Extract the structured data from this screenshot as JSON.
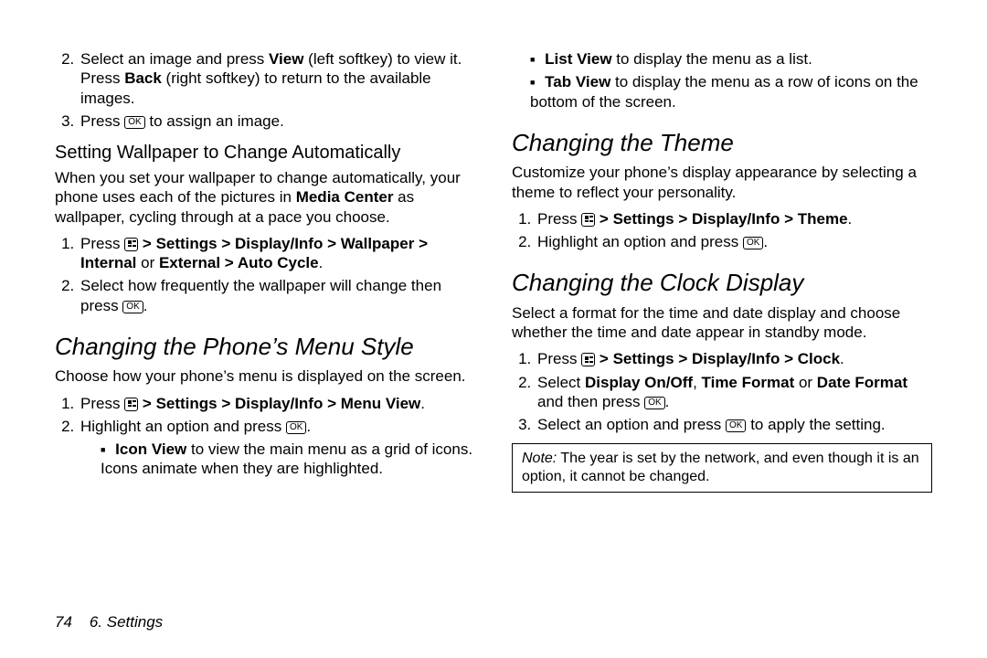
{
  "left": {
    "step2": {
      "prefix": "Select an image and press ",
      "view": "View",
      "mid": " (left softkey) to view it. Press ",
      "back": "Back",
      "suffix": " (right softkey) to return to the available images."
    },
    "step3_a": "Press ",
    "step3_b": " to assign an image.",
    "wall_heading": "Setting Wallpaper to Change Automatically",
    "wall_intro_a": "When you set your wallpaper to change automatically, your phone uses each of the pictures in ",
    "wall_intro_b": "Media Center",
    "wall_intro_c": " as wallpaper, cycling through at a pace you choose.",
    "wall_s1_a": "Press ",
    "wall_s1_b": " > ",
    "wall_s1_settings": "Settings",
    "wall_s1_display": "Display/Info",
    "wall_s1_wall": "Wallpaper",
    "wall_s1_internal": "Internal",
    "wall_s1_or": " or ",
    "wall_s1_external": "External",
    "wall_s1_auto": "Auto Cycle",
    "wall_s1_end": ".",
    "wall_s2_a": "Select how frequently the wallpaper will change then press ",
    "wall_s2_b": ".",
    "menu_heading": "Changing the Phone’s Menu Style",
    "menu_intro": "Choose how your phone’s menu is displayed on the screen.",
    "menu_s1_a": "Press ",
    "menu_s1_b": " > ",
    "menu_s1_settings": "Settings",
    "menu_s1_display": "Display/Info",
    "menu_s1_view": "Menu View",
    "menu_s1_end": ".",
    "menu_s2_a": "Highlight an option and press ",
    "menu_s2_b": ".",
    "menu_icon_view_label": "Icon View",
    "menu_icon_view_text": " to view the main menu as a grid of icons. Icons animate when they are highlighted."
  },
  "right": {
    "list_view_label": "List View",
    "list_view_text": " to display the menu as a list.",
    "tab_view_label": "Tab View",
    "tab_view_text": " to display the menu as a row of icons on the bottom of the screen.",
    "theme_heading": "Changing the Theme",
    "theme_intro": "Customize your phone’s display appearance by selecting a theme to reflect your personality.",
    "theme_s1_a": "Press ",
    "theme_s1_b": " > ",
    "theme_s1_settings": "Settings",
    "theme_s1_display": "Display/Info",
    "theme_s1_theme": "Theme",
    "theme_s1_end": ".",
    "theme_s2_a": "Highlight an option and press ",
    "theme_s2_b": ".",
    "clock_heading": "Changing the Clock Display",
    "clock_intro": "Select a format for the time and date display and choose whether the time and date appear in standby mode.",
    "clock_s1_a": "Press ",
    "clock_s1_b": " > ",
    "clock_s1_settings": "Settings",
    "clock_s1_display": "Display/Info",
    "clock_s1_clock": "Clock",
    "clock_s1_end": ".",
    "clock_s2_a": "Select ",
    "clock_s2_onoff": "Display On/Off",
    "clock_s2_c1": ", ",
    "clock_s2_tf": "Time Format",
    "clock_s2_or": " or ",
    "clock_s2_df": "Date Format",
    "clock_s2_then": " and then press ",
    "clock_s2_end": ".",
    "clock_s3_a": "Select an option and press ",
    "clock_s3_b": " to apply the setting.",
    "note_label": "Note:",
    "note_text": " The year is set by the network, and even though it is an option, it cannot be changed."
  },
  "ok_key": "OK",
  "footer": {
    "page": "74",
    "chapter": "6. Settings"
  }
}
